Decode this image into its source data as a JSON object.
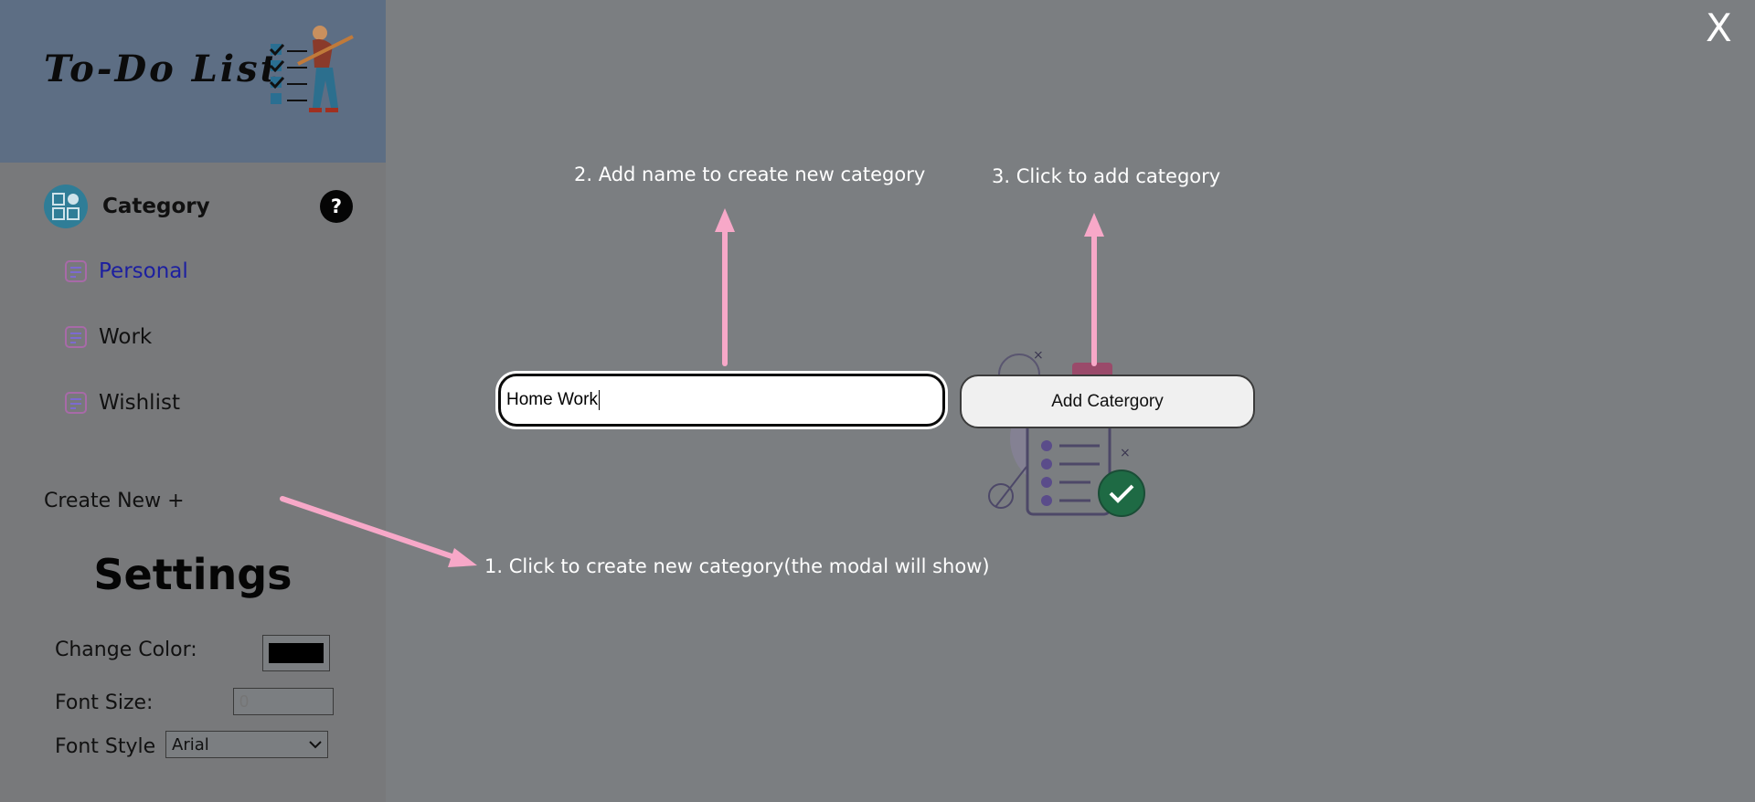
{
  "sidebar": {
    "logo_text": "To-Do List",
    "category_title": "Category",
    "help_label": "?",
    "items": [
      {
        "label": "Personal"
      },
      {
        "label": "Work"
      },
      {
        "label": "Wishlist"
      }
    ],
    "create_new": "Create New +"
  },
  "settings": {
    "title": "Settings",
    "change_color_label": "Change Color:",
    "color_value": "#000000",
    "font_size_label": "Font Size:",
    "font_size_placeholder": "0",
    "font_style_label": "Font Style",
    "font_style_value": "Arial"
  },
  "modal": {
    "close_label": "X",
    "input_value": "Home Work",
    "add_button_label": "Add Catergory"
  },
  "hints": {
    "step1": "1. Click to create new category(the modal will show)",
    "step2": "2. Add name to create new category",
    "step3": "3. Click to add category"
  },
  "colors": {
    "overlay": "#7b7e81",
    "arrow": "#f7a8c8",
    "active_item": "#1c1fa0"
  }
}
